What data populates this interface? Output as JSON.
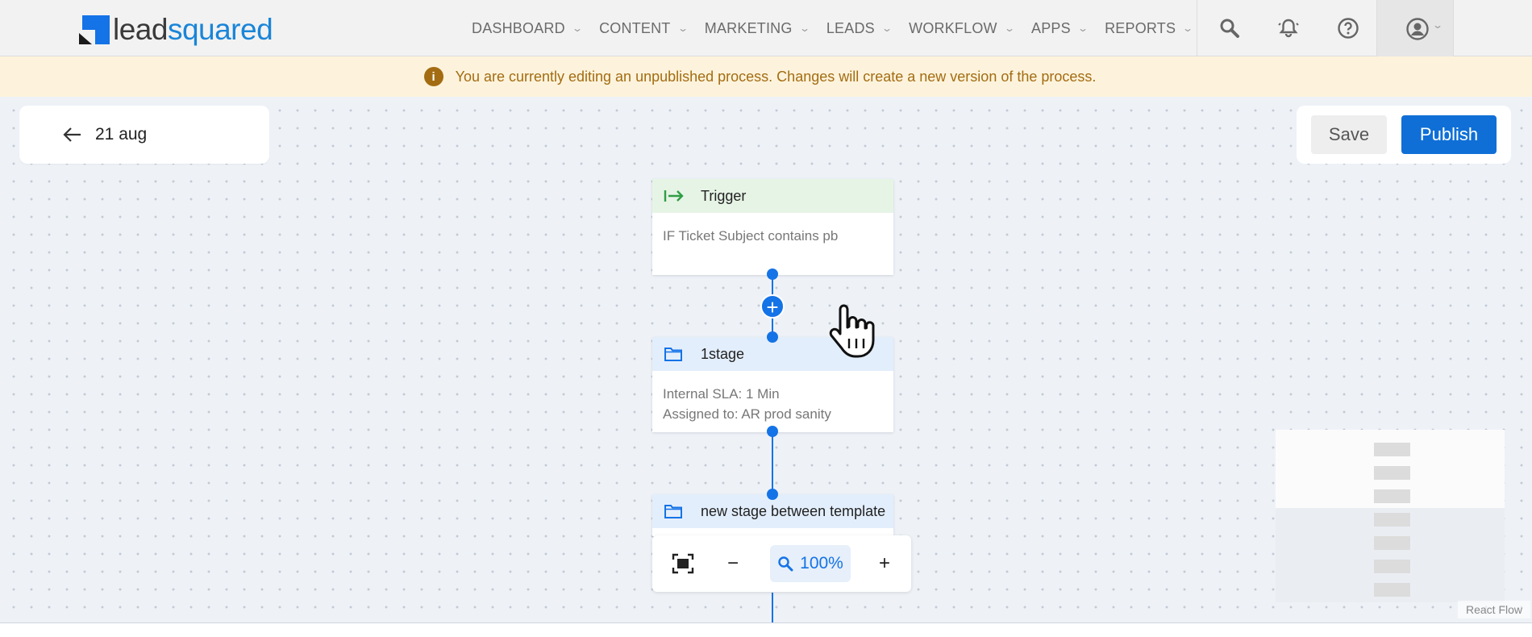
{
  "header": {
    "logo": {
      "part1": "lead",
      "part2": "squared"
    },
    "nav": [
      {
        "label": "DASHBOARD"
      },
      {
        "label": "CONTENT"
      },
      {
        "label": "MARKETING"
      },
      {
        "label": "LEADS"
      },
      {
        "label": "WORKFLOW"
      },
      {
        "label": "APPS"
      },
      {
        "label": "REPORTS"
      }
    ],
    "icons": [
      "search-icon",
      "bell-icon",
      "help-icon",
      "profile-icon"
    ]
  },
  "banner": {
    "text": "You are currently editing an unpublished process. Changes will create a new version of the process."
  },
  "process": {
    "title": "21 aug",
    "save_label": "Save",
    "publish_label": "Publish"
  },
  "nodes": [
    {
      "type": "trigger",
      "title": "Trigger",
      "lines": [
        "IF Ticket Subject contains pb"
      ]
    },
    {
      "type": "stage",
      "title": "1stage",
      "lines": [
        "Internal SLA: 1 Min",
        "Assigned to: AR prod sanity"
      ]
    },
    {
      "type": "stage",
      "title": "new stage between template",
      "lines": []
    }
  ],
  "controls": {
    "zoom_label": "100%",
    "zoom_out": "−",
    "zoom_in": "+"
  },
  "attribution": "React Flow",
  "colors": {
    "accent": "#1473e6",
    "banner_text": "#a36c12",
    "trigger_head": "#e6f4e6",
    "stage_head": "#e3eefc"
  }
}
